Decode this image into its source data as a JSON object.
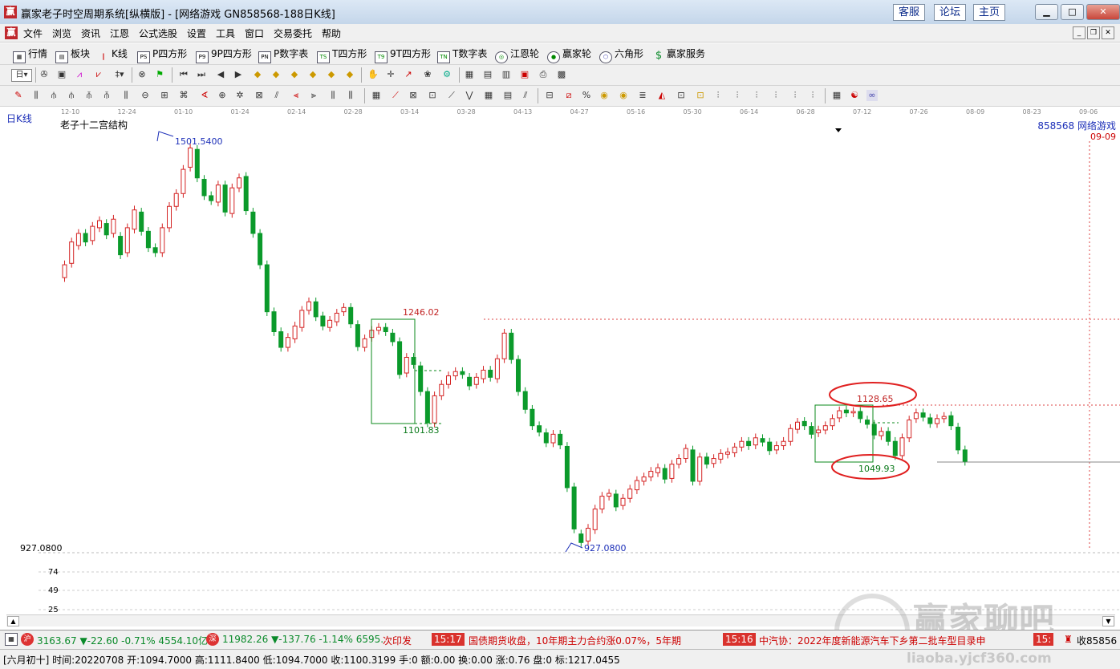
{
  "window": {
    "title": "赢家老子时空周期系统[纵横版] - [网络游戏  GN858568-188日K线]",
    "links": [
      "客服",
      "论坛",
      "主页"
    ]
  },
  "menu": [
    "文件",
    "浏览",
    "资讯",
    "江恩",
    "公式选股",
    "设置",
    "工具",
    "窗口",
    "交易委托",
    "帮助"
  ],
  "toolbar": [
    "行情",
    "板块",
    "K线",
    "P四方形",
    "9P四方形",
    "P数字表",
    "T四方形",
    "9T四方形",
    "T数字表",
    "江恩轮",
    "赢家轮",
    "六角形",
    "赢家服务"
  ],
  "date_axis": [
    "12-10",
    "12-24",
    "01-10",
    "01-24",
    "02-14",
    "02-28",
    "03-14",
    "03-28",
    "04-13",
    "04-27",
    "05-16",
    "05-30",
    "06-14",
    "06-28",
    "07-12",
    "07-26",
    "08-09",
    "08-23",
    "09-06"
  ],
  "chart": {
    "period_label": "日K线",
    "indicator_name": "老子十二宫结构",
    "stock_label": "858568 网络游戏",
    "cursor_date": "09-09",
    "y_axis_min_label": "927.0800",
    "sub_axis": [
      "74",
      "49",
      "25"
    ],
    "annotations": {
      "high": "1501.5400",
      "low": "927.0800",
      "box1_top": "1246.02",
      "box1_bottom": "1101.83",
      "box2_top": "1128.65",
      "box2_bottom": "1049.93"
    },
    "colors": {
      "up": "#d42323",
      "down": "#0b9a2b",
      "box": "#0b8a1b",
      "highlight": "#e02020",
      "axis_text": "#1c2fb8"
    }
  },
  "chart_data": {
    "type": "candlestick",
    "title": "老子十二宫结构",
    "ylim": [
      927.08,
      1501.54
    ],
    "x_start": "12-10",
    "candles": [
      [
        1310,
        1328
      ],
      [
        1330,
        1360
      ],
      [
        1355,
        1372
      ],
      [
        1372,
        1360
      ],
      [
        1362,
        1382
      ],
      [
        1380,
        1390
      ],
      [
        1386,
        1370
      ],
      [
        1372,
        1392
      ],
      [
        1368,
        1342
      ],
      [
        1345,
        1380
      ],
      [
        1378,
        1405
      ],
      [
        1402,
        1375
      ],
      [
        1375,
        1352
      ],
      [
        1352,
        1345
      ],
      [
        1345,
        1380
      ],
      [
        1380,
        1410
      ],
      [
        1410,
        1428
      ],
      [
        1428,
        1462
      ],
      [
        1465,
        1492
      ],
      [
        1490,
        1450
      ],
      [
        1448,
        1425
      ],
      [
        1425,
        1418
      ],
      [
        1416,
        1440
      ],
      [
        1440,
        1402
      ],
      [
        1400,
        1436
      ],
      [
        1436,
        1450
      ],
      [
        1452,
        1404
      ],
      [
        1402,
        1372
      ],
      [
        1372,
        1328
      ],
      [
        1328,
        1262
      ],
      [
        1262,
        1234
      ],
      [
        1234,
        1212
      ],
      [
        1212,
        1226
      ],
      [
        1224,
        1242
      ],
      [
        1240,
        1264
      ],
      [
        1264,
        1276
      ],
      [
        1276,
        1255
      ],
      [
        1256,
        1242
      ],
      [
        1240,
        1250
      ],
      [
        1248,
        1260
      ],
      [
        1262,
        1268
      ],
      [
        1268,
        1245
      ],
      [
        1244,
        1213
      ],
      [
        1212,
        1224
      ],
      [
        1226,
        1236
      ],
      [
        1236,
        1240
      ],
      [
        1240,
        1234
      ],
      [
        1232,
        1220
      ],
      [
        1220,
        1174
      ],
      [
        1176,
        1198
      ],
      [
        1198,
        1188
      ],
      [
        1186,
        1150
      ],
      [
        1150,
        1106
      ],
      [
        1106,
        1144
      ],
      [
        1144,
        1160
      ],
      [
        1160,
        1172
      ],
      [
        1172,
        1178
      ],
      [
        1178,
        1174
      ],
      [
        1170,
        1158
      ],
      [
        1160,
        1170
      ],
      [
        1168,
        1180
      ],
      [
        1180,
        1170
      ],
      [
        1168,
        1196
      ],
      [
        1196,
        1232
      ],
      [
        1232,
        1195
      ],
      [
        1195,
        1150
      ],
      [
        1150,
        1125
      ],
      [
        1125,
        1102
      ],
      [
        1102,
        1093
      ],
      [
        1092,
        1078
      ],
      [
        1078,
        1090
      ],
      [
        1090,
        1075
      ],
      [
        1073,
        1015
      ],
      [
        1016,
        957
      ],
      [
        950,
        938
      ],
      [
        940,
        958
      ],
      [
        956,
        985
      ],
      [
        985,
        1003
      ],
      [
        1003,
        1007
      ],
      [
        1006,
        988
      ],
      [
        990,
        1000
      ],
      [
        1000,
        1013
      ],
      [
        1012,
        1025
      ],
      [
        1024,
        1030
      ],
      [
        1030,
        1038
      ],
      [
        1036,
        1043
      ],
      [
        1042,
        1027
      ],
      [
        1028,
        1048
      ],
      [
        1048,
        1056
      ],
      [
        1056,
        1070
      ],
      [
        1068,
        1024
      ],
      [
        1024,
        1058
      ],
      [
        1058,
        1048
      ],
      [
        1049,
        1056
      ],
      [
        1055,
        1063
      ],
      [
        1062,
        1065
      ],
      [
        1064,
        1072
      ],
      [
        1072,
        1080
      ],
      [
        1080,
        1074
      ],
      [
        1075,
        1085
      ],
      [
        1084,
        1079
      ],
      [
        1079,
        1067
      ],
      [
        1068,
        1074
      ],
      [
        1074,
        1080
      ],
      [
        1080,
        1098
      ],
      [
        1097,
        1107
      ],
      [
        1108,
        1102
      ],
      [
        1101,
        1090
      ],
      [
        1092,
        1096
      ],
      [
        1096,
        1102
      ],
      [
        1102,
        1112
      ],
      [
        1113,
        1123
      ],
      [
        1124,
        1120
      ],
      [
        1120,
        1122
      ],
      [
        1122,
        1112
      ],
      [
        1110,
        1104
      ],
      [
        1104,
        1089
      ],
      [
        1088,
        1094
      ],
      [
        1094,
        1080
      ],
      [
        1080,
        1060
      ],
      [
        1060,
        1085
      ],
      [
        1085,
        1110
      ],
      [
        1112,
        1120
      ],
      [
        1120,
        1114
      ],
      [
        1113,
        1105
      ],
      [
        1105,
        1112
      ],
      [
        1112,
        1115
      ],
      [
        1116,
        1102
      ],
      [
        1100,
        1068
      ],
      [
        1068,
        1052
      ]
    ]
  },
  "ticker": {
    "sh_index": "3163.67 ▼-22.60 -0.71% 4554.10亿",
    "sz_index": "11982.26 ▼-137.76 -1.14% 6595.5",
    "news": [
      {
        "text": "次印发"
      },
      {
        "time": "15:17",
        "text": "国债期货收盘，10年期主力合约涨0.07%，5年期"
      },
      {
        "time": "15:16",
        "text": "中汽协：2022年度新能源汽车下乡第二批车型目录申"
      },
      {
        "time": "15:",
        "text": ""
      }
    ],
    "tail": "收85856"
  },
  "info_bar": "[六月初十] 时间:20220708 开:1094.7000 高:1111.8400 低:1094.7000 收:1100.3199 手:0 额:0.00 换:0.00 涨:0.76 盘:0 标:1217.0455",
  "watermark": {
    "brand": "赢家聊吧",
    "url": "liaoba.yjcf360.com"
  }
}
